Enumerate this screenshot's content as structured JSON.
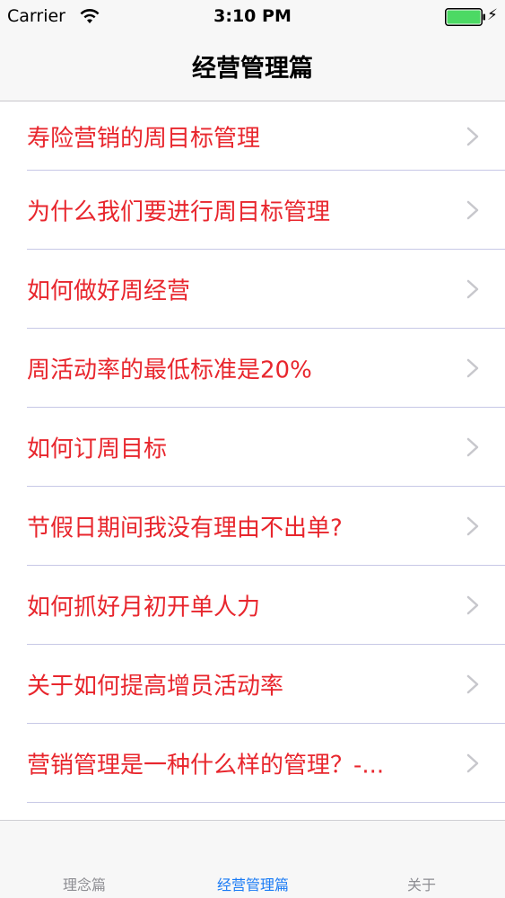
{
  "status_bar": {
    "carrier": "Carrier",
    "time": "3:10 PM",
    "wifi_icon": "wifi-icon",
    "battery_icon": "battery-icon",
    "charging_icon": "charging-bolt-icon",
    "battery_color": "#4cd964"
  },
  "nav": {
    "title": "经营管理篇"
  },
  "list": {
    "text_color": "#e8262d",
    "items": [
      {
        "label": "寿险营销的周目标管理"
      },
      {
        "label": "为什么我们要进行周目标管理"
      },
      {
        "label": "如何做好周经营"
      },
      {
        "label": "周活动率的最低标准是20%"
      },
      {
        "label": "如何订周目标"
      },
      {
        "label": "节假日期间我没有理由不出单?"
      },
      {
        "label": "如何抓好月初开单人力"
      },
      {
        "label": "关于如何提高增员活动率"
      },
      {
        "label": "营销管理是一种什么样的管理？-..."
      }
    ]
  },
  "tab_bar": {
    "active_color": "#1a7bf5",
    "tabs": [
      {
        "label": "理念篇"
      },
      {
        "label": "经营管理篇"
      },
      {
        "label": "关于"
      }
    ]
  }
}
